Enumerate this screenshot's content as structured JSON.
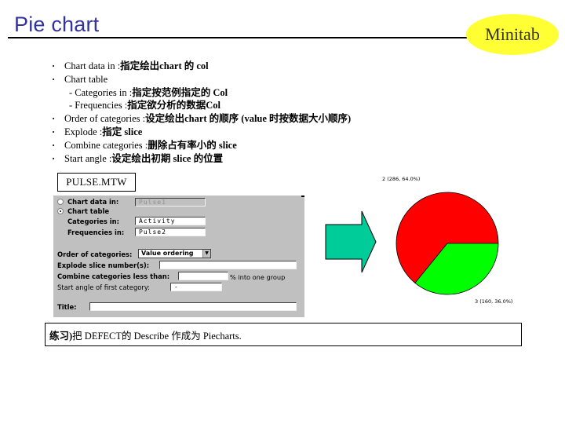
{
  "header": {
    "title": "Pie chart",
    "brand": "Minitab"
  },
  "bullets": [
    {
      "type": "bullet",
      "term": "Chart data in : ",
      "desc": "指定绘出chart 的 col"
    },
    {
      "type": "bullet",
      "term": "Chart table",
      "desc": ""
    },
    {
      "type": "sub",
      "term": "- Categories in : ",
      "desc": "指定按范例指定的 Col"
    },
    {
      "type": "sub",
      "term": "- Frequencies : ",
      "desc": "指定欲分析的数据Col"
    },
    {
      "type": "bullet",
      "term": "Order of categories : ",
      "desc": "设定绘出chart 的顺序 (value 时按数据大小顺序)"
    },
    {
      "type": "bullet",
      "term": "Explode : ",
      "desc": "指定 slice"
    },
    {
      "type": "bullet",
      "term": "Combine categories : ",
      "desc": "删除占有率小的 slice"
    },
    {
      "type": "bullet",
      "term": "Start angle : ",
      "desc": "设定绘出初期 slice 的位置"
    }
  ],
  "file_label": "PULSE.MTW",
  "dialog": {
    "chart_data_in": {
      "label": "Chart data in:",
      "value": "Pulse1",
      "selected": false
    },
    "chart_table": {
      "label": "Chart table",
      "selected": true
    },
    "categories_in": {
      "label": "Categories in:",
      "value": "Activity"
    },
    "frequencies_in": {
      "label": "Frequencies in:",
      "value": "Pulse2"
    },
    "order_of_categories": {
      "label": "Order of categories:",
      "value": "Value ordering"
    },
    "explode_slice": {
      "label": "Explode slice number(s):",
      "value": ""
    },
    "combine_categories": {
      "label": "Combine categories less than:",
      "value": "",
      "suffix": "% into one group"
    },
    "start_angle": {
      "label": "Start angle of first category:",
      "value": "-"
    },
    "title": {
      "label": "Title:",
      "value": ""
    }
  },
  "chart_data": {
    "type": "pie",
    "title": "",
    "categories": [
      "2",
      "3"
    ],
    "values": [
      286,
      160
    ],
    "percents": [
      64.0,
      36.0
    ],
    "labels": [
      "2 (286, 64.0%)",
      "3 (160, 36.0%)"
    ],
    "colors": [
      "#ff0000",
      "#00ff00"
    ],
    "start_angle_deg": 0
  },
  "exercise": {
    "prefix": "练习)",
    "text": " 把 DEFECT的 Describe 作成为 Piecharts."
  },
  "colors": {
    "title": "#3333a0",
    "brand_oval": "#ffff33",
    "arrow": "#00cc99",
    "dialog_bg": "#c0c0c0"
  }
}
